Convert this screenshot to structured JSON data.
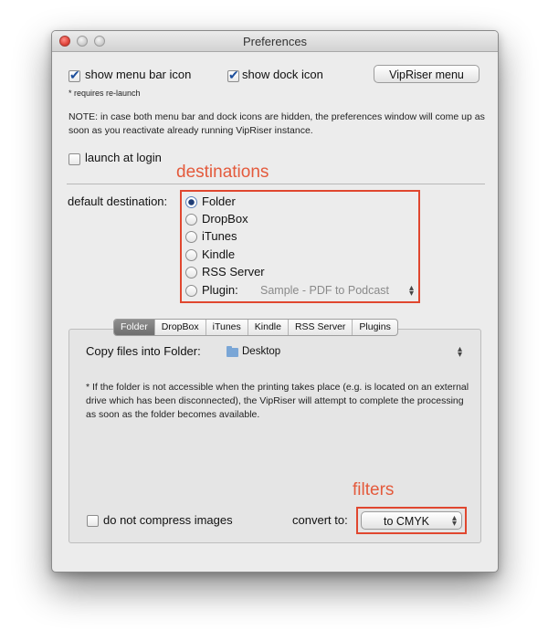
{
  "window": {
    "title": "Preferences"
  },
  "top": {
    "show_menu_bar_icon": {
      "label": "show menu bar icon",
      "checked": true
    },
    "show_dock_icon": {
      "label": "show dock icon",
      "checked": true
    },
    "vipriser_menu_button": "VipRiser menu",
    "requires_relaunch": "* requires re-launch",
    "note": "NOTE: in case both menu bar and dock icons are hidden, the preferences window will come up as soon as you reactivate already running VipRiser instance.",
    "launch_at_login": {
      "label": "launch at login",
      "checked": false
    }
  },
  "annotations": {
    "destinations": "destinations",
    "filters": "filters"
  },
  "destinations": {
    "label": "default destination:",
    "options": [
      {
        "label": "Folder",
        "selected": true
      },
      {
        "label": "DropBox",
        "selected": false
      },
      {
        "label": "iTunes",
        "selected": false
      },
      {
        "label": "Kindle",
        "selected": false
      },
      {
        "label": "RSS Server",
        "selected": false
      },
      {
        "label": "Plugin:",
        "selected": false
      }
    ],
    "plugin_select": "Sample - PDF to Podcast"
  },
  "tabs": [
    "Folder",
    "DropBox",
    "iTunes",
    "Kindle",
    "RSS Server",
    "Plugins"
  ],
  "active_tab": "Folder",
  "folder_tab": {
    "copy_label": "Copy files into Folder:",
    "folder_value": "Desktop",
    "note": "* If the folder is not accessible when the printing takes place (e.g. is located on an external drive which has been disconnected), the VipRiser will attempt to complete the processing as soon as the folder becomes available."
  },
  "bottom": {
    "do_not_compress": {
      "label": "do not compress images",
      "checked": false
    },
    "convert_label": "convert to:",
    "convert_value": "to CMYK"
  },
  "colors": {
    "annotation_red": "#e0472f",
    "selected_tab": "#7a7a7a"
  },
  "icons": [
    "close-icon",
    "minimize-icon",
    "zoom-icon",
    "checkmark-icon",
    "folder-icon",
    "updown-arrows-icon"
  ]
}
